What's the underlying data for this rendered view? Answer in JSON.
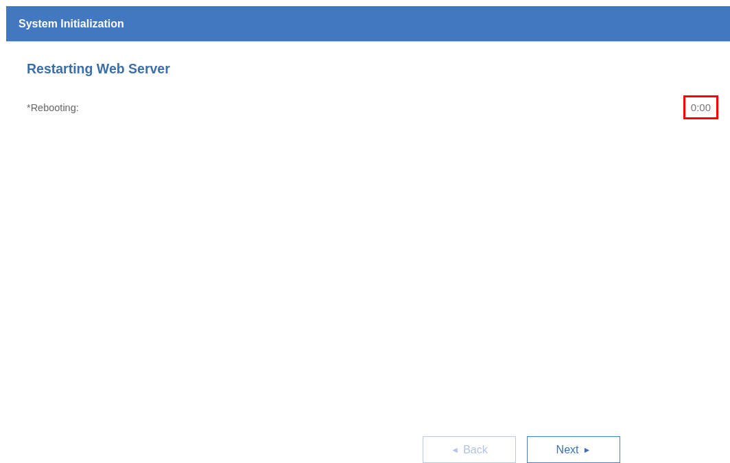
{
  "window": {
    "title": "System Initialization"
  },
  "heading": "Restarting Web Server",
  "field": {
    "label": "*Rebooting:",
    "value": "0:00",
    "highlighted": true
  },
  "buttons": [
    {
      "kind": "back",
      "icon": "◄",
      "label": "Back",
      "disabled": true
    },
    {
      "kind": "next",
      "icon": "►",
      "label": "Next",
      "disabled": false
    }
  ]
}
